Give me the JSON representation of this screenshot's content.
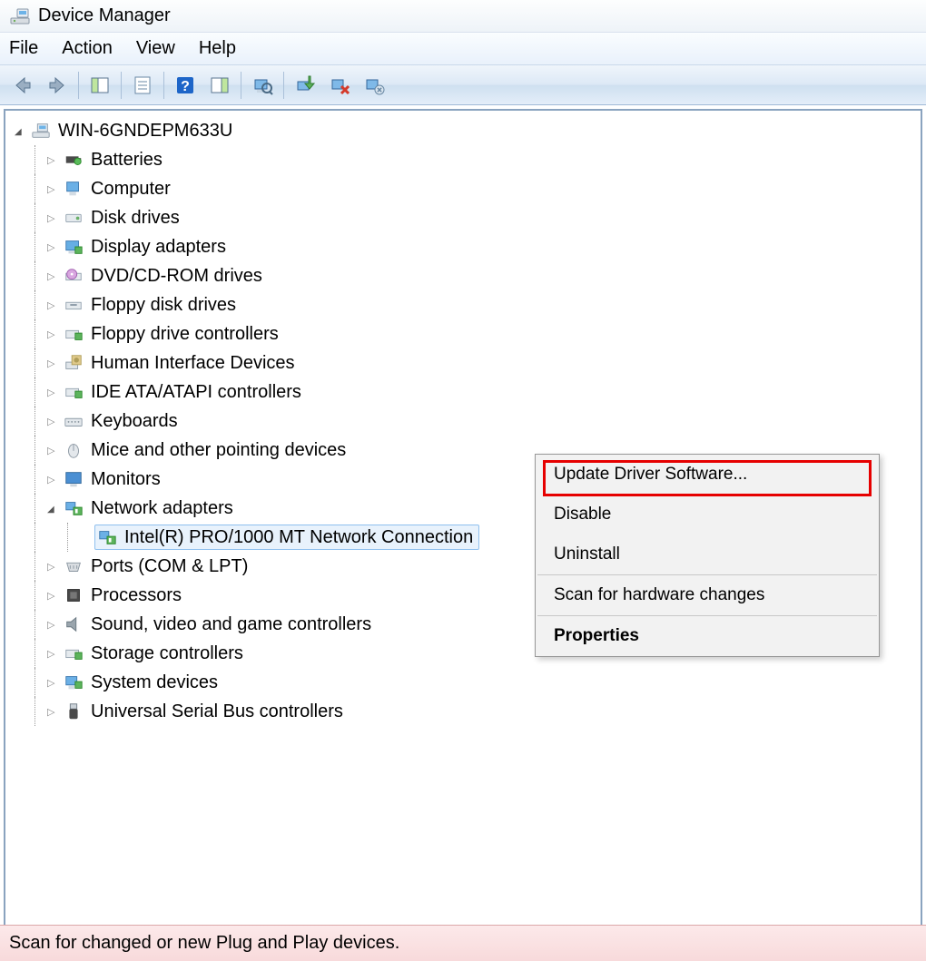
{
  "window": {
    "title": "Device Manager"
  },
  "menu": {
    "file": "File",
    "action": "Action",
    "view": "View",
    "help": "Help"
  },
  "tree": {
    "root": "WIN-6GNDEPM633U",
    "batteries": "Batteries",
    "computer": "Computer",
    "disk": "Disk drives",
    "display": "Display adapters",
    "dvd": "DVD/CD-ROM drives",
    "floppy_disk": "Floppy disk drives",
    "floppy_ctrl": "Floppy drive controllers",
    "hid": "Human Interface Devices",
    "ide": "IDE ATA/ATAPI controllers",
    "keyboards": "Keyboards",
    "mice": "Mice and other pointing devices",
    "monitors": "Monitors",
    "network": "Network adapters",
    "network_child": "Intel(R) PRO/1000 MT Network Connection",
    "ports": "Ports (COM & LPT)",
    "processors": "Processors",
    "sound": "Sound, video and game controllers",
    "storage": "Storage controllers",
    "system": "System devices",
    "usb": "Universal Serial Bus controllers"
  },
  "context_menu": {
    "update": "Update Driver Software...",
    "disable": "Disable",
    "uninstall": "Uninstall",
    "scan": "Scan for hardware changes",
    "properties": "Properties"
  },
  "status": "Scan for changed or new Plug and Play devices."
}
